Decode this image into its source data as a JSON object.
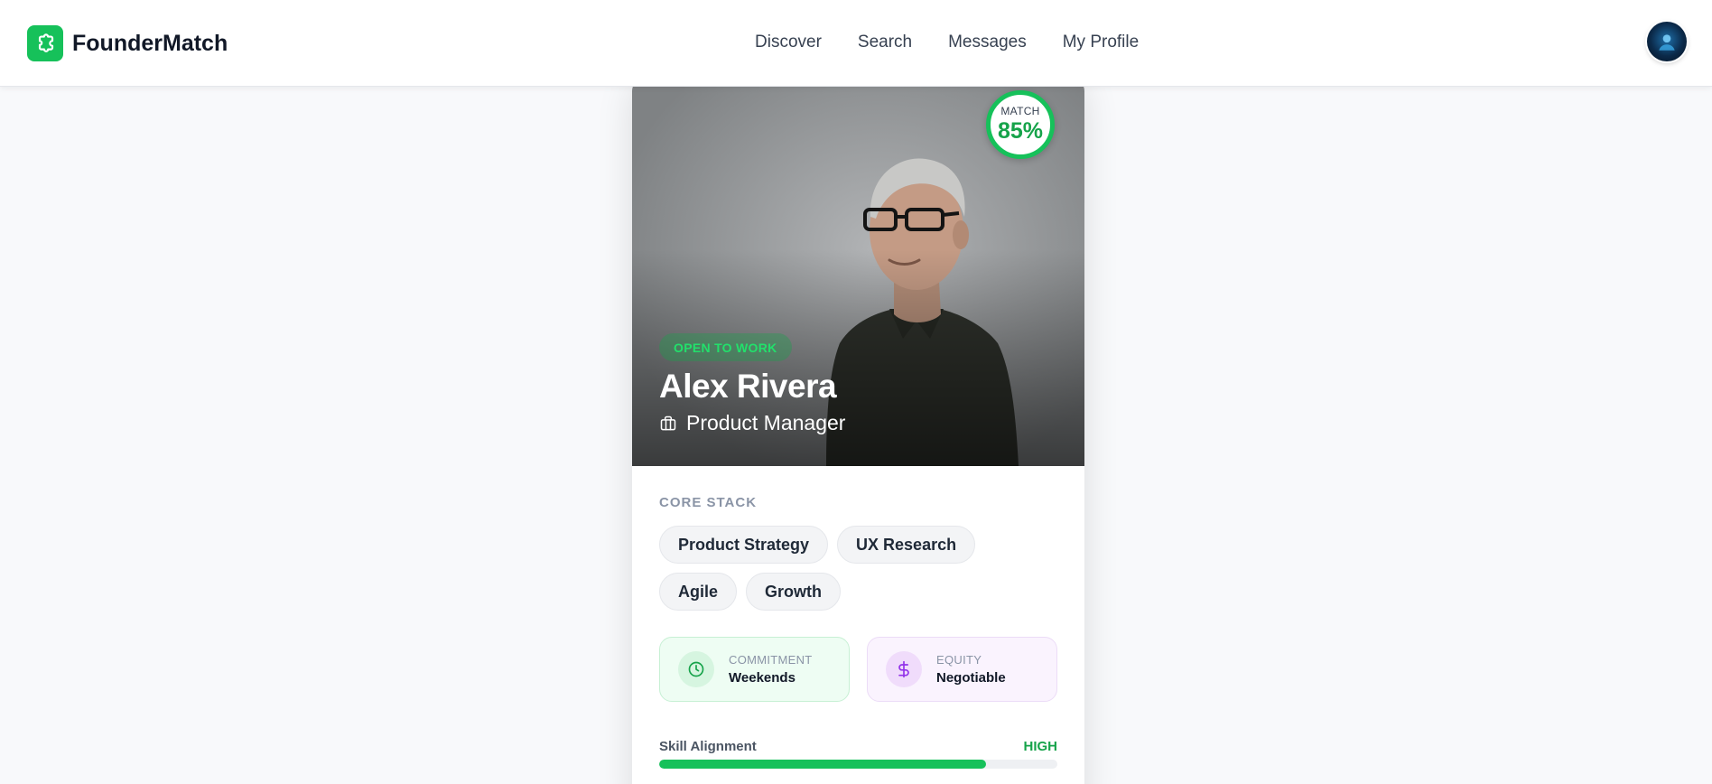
{
  "header": {
    "brand": "FounderMatch",
    "brand_icon": "puzzle-icon",
    "nav": [
      {
        "label": "Discover"
      },
      {
        "label": "Search"
      },
      {
        "label": "Messages"
      },
      {
        "label": "My Profile"
      }
    ],
    "avatar_icon": "user-avatar"
  },
  "profile": {
    "match_label": "MATCH",
    "match_value": "85%",
    "status": "OPEN TO WORK",
    "name": "Alex Rivera",
    "role": "Product Manager",
    "role_icon": "briefcase-icon",
    "core_stack_label": "CORE STACK",
    "skills": [
      "Product Strategy",
      "UX Research",
      "Agile",
      "Growth"
    ],
    "commitment": {
      "label": "COMMITMENT",
      "value": "Weekends",
      "icon": "clock-icon"
    },
    "equity": {
      "label": "EQUITY",
      "value": "Negotiable",
      "icon": "dollar-icon"
    },
    "skill_alignment": {
      "label": "Skill Alignment",
      "value": "HIGH",
      "fill_fraction": 0.82
    }
  },
  "colors": {
    "accent": "#16c15a",
    "accent_text": "#16a34a",
    "equity_accent": "#9333ea"
  }
}
